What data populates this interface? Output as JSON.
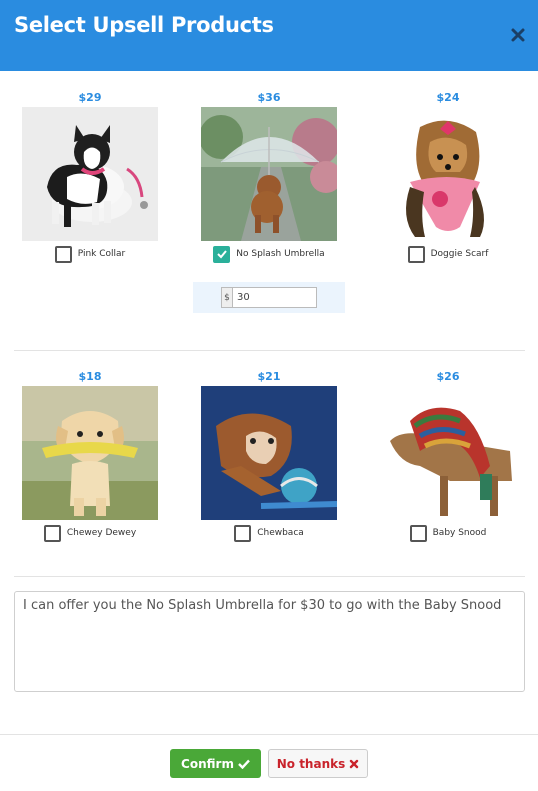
{
  "header": {
    "title": "Select Upsell Products",
    "close_icon": "close-icon"
  },
  "products": [
    {
      "price": "$29",
      "label": "Pink Collar",
      "checked": false
    },
    {
      "price": "$36",
      "label": "No Splash Umbrella",
      "checked": true
    },
    {
      "price": "$24",
      "label": "Doggie Scarf",
      "checked": false
    },
    {
      "price": "$18",
      "label": "Chewey Dewey",
      "checked": false
    },
    {
      "price": "$21",
      "label": "Chewbaca",
      "checked": false
    },
    {
      "price": "$26",
      "label": "Baby Snood",
      "checked": false
    }
  ],
  "custom_price": {
    "currency": "$",
    "value": "30"
  },
  "message": "I can offer you the No Splash Umbrella for $30 to go with the Baby Snood",
  "footer": {
    "confirm_label": "Confirm",
    "no_thanks_label": "No thanks"
  },
  "colors": {
    "header": "#2a8ce0",
    "price": "#2a8ce0",
    "checked": "#2ab09a",
    "confirm": "#4aa838",
    "no_thanks_text": "#c9232b"
  }
}
